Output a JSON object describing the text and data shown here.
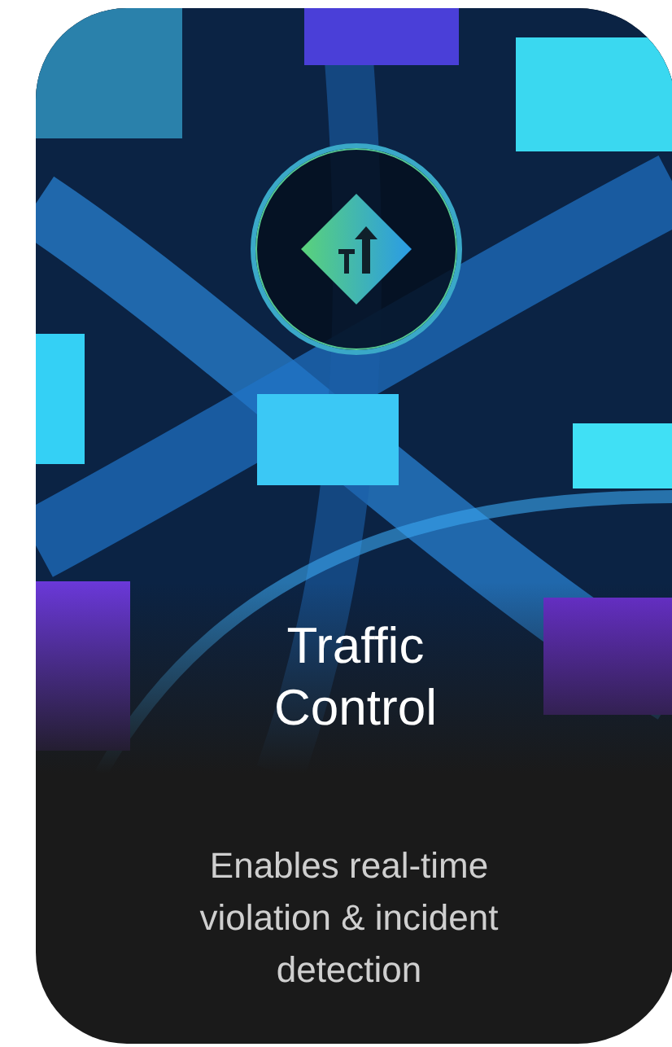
{
  "card": {
    "title": "Traffic Control",
    "description": "Enables real-time violation & incident detection"
  }
}
